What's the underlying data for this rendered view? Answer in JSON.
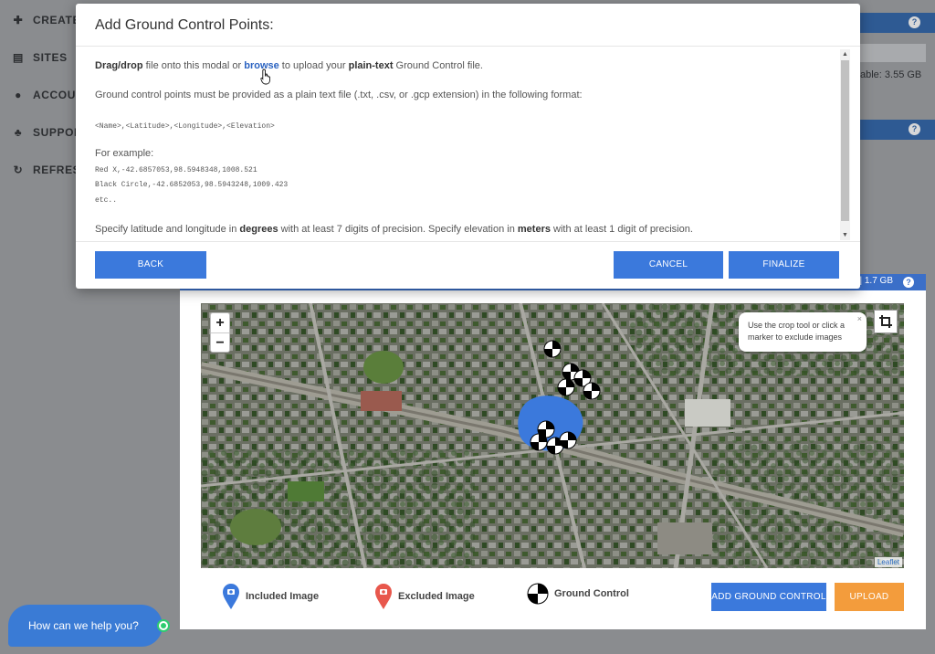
{
  "sidebar": {
    "items": [
      {
        "label": "CREATE",
        "icon": "plus-icon"
      },
      {
        "label": "SITES",
        "icon": "file-icon"
      },
      {
        "label": "ACCOUN",
        "icon": "user-icon"
      },
      {
        "label": "SUPPOR",
        "icon": "users-icon"
      },
      {
        "label": "REFRES",
        "icon": "refresh-icon"
      }
    ]
  },
  "background": {
    "storage_available": "able: 3.55 GB",
    "help_icon": "?"
  },
  "modal": {
    "title": "Add Ground Control Points:",
    "intro": {
      "part1": "Drag/drop",
      "part2": " file onto this modal or ",
      "link": "browse",
      "part3": " to upload your ",
      "bold2": "plain-text",
      "part4": " Ground Control file."
    },
    "format_line": "Ground control points must be provided as a plain text file (.txt, .csv, or .gcp extension) in the following format:",
    "format_code": "<Name>,<Latitude>,<Longitude>,<Elevation>",
    "example_heading": "For example:",
    "example_lines": [
      "Red X,-42.6857053,98.5948348,1008.521",
      "Black Circle,-42.6852053,98.5943248,1009.423",
      "etc.."
    ],
    "precision": {
      "part1": "Specify latitude and longitude in ",
      "bold1": "degrees",
      "part2": " with at least 7 digits of precision. Specify elevation in ",
      "bold2": "meters",
      "part3": " with at least 1 digit of precision."
    },
    "buttons": {
      "back": "BACK",
      "cancel": "CANCEL",
      "finalize": "FINALIZE"
    }
  },
  "card": {
    "storage": "| 1.7 GB",
    "help_icon": "?",
    "map": {
      "zoom_in": "+",
      "zoom_out": "−",
      "tip": "Use the crop tool or click a marker to exclude images",
      "tip_close": "×",
      "attribution": "Leaflet"
    },
    "legend": {
      "included": "Included Image",
      "excluded": "Excluded Image",
      "ground_control": "Ground Control"
    },
    "buttons": {
      "add_ground_control": "ADD GROUND CONTROL",
      "upload": "UPLOAD"
    }
  },
  "chat": {
    "label": "How can we help you?"
  },
  "colors": {
    "primary": "#3b79dc",
    "upload": "#f39c3c",
    "included_marker": "#3b79dc",
    "excluded_marker": "#e8574c"
  }
}
